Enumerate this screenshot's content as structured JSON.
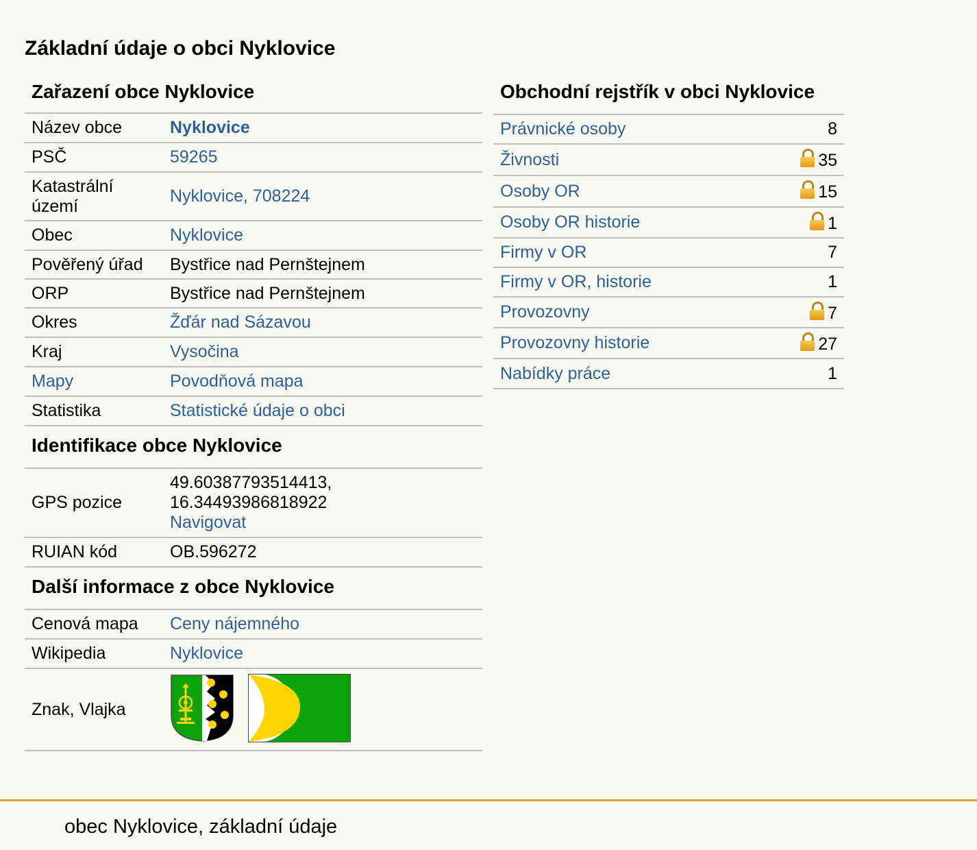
{
  "page_title": "Základní údaje o obci Nyklovice",
  "classification": {
    "title": "Zařazení obce Nyklovice",
    "rows": [
      {
        "label": "Název obce",
        "value": "Nyklovice"
      },
      {
        "label": "PSČ",
        "value": "59265"
      },
      {
        "label": "Katastrální území",
        "value": "Nyklovice, 708224"
      },
      {
        "label": "Obec",
        "value": "Nyklovice"
      },
      {
        "label": "Pověřený úřad",
        "value": "Bystřice nad Pernštejnem"
      },
      {
        "label": "ORP",
        "value": "Bystřice nad Pernštejnem"
      },
      {
        "label": "Okres",
        "value": "Žďár nad Sázavou"
      },
      {
        "label": "Kraj",
        "value": "Vysočina"
      },
      {
        "label": "Mapy",
        "value": "Povodňová mapa"
      },
      {
        "label": "Statistika",
        "value": "Statistické údaje o obci"
      }
    ]
  },
  "identification": {
    "title": "Identifikace obce Nyklovice",
    "gps_label": "GPS pozice",
    "gps_lat": "49.60387793514413,",
    "gps_lon": "16.34493986818922",
    "navigate": "Navigovat",
    "ruian_label": "RUIAN kód",
    "ruian_value": "OB.596272"
  },
  "more_info": {
    "title": "Další informace z obce Nyklovice",
    "price_map_label": "Cenová mapa",
    "price_map_value": "Ceny nájemného",
    "wikipedia_label": "Wikipedia",
    "wikipedia_value": "Nyklovice",
    "emblem_label": "Znak, Vlajka",
    "colors": {
      "green": "#0aa30a",
      "yellow": "#ffd400",
      "black": "#000000"
    }
  },
  "registry": {
    "title": "Obchodní rejstřík v obci Nyklovice",
    "rows": [
      {
        "label": "Právnické osoby",
        "count": "8"
      },
      {
        "label": "Živnosti",
        "count": "35"
      },
      {
        "label": "Osoby OR",
        "count": "15"
      },
      {
        "label": "Osoby OR historie",
        "count": "1"
      },
      {
        "label": "Firmy v OR",
        "count": "7"
      },
      {
        "label": "Firmy v OR, historie",
        "count": "1"
      },
      {
        "label": "Provozovny",
        "count": "7"
      },
      {
        "label": "Provozovny historie",
        "count": "27"
      },
      {
        "label": "Nabídky práce",
        "count": "1"
      }
    ],
    "lock_icon": "padlock-icon"
  },
  "footer": {
    "text": "obec Nyklovice, základní údaje",
    "accent": "#d4a82a"
  }
}
